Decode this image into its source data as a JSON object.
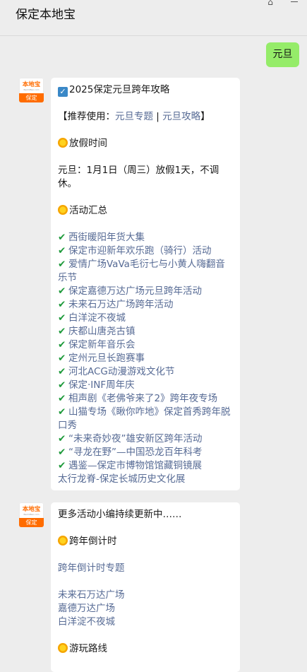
{
  "header": {
    "title": "保定本地宝",
    "pin_icon": "pin-icon",
    "minimize_icon": "minimize-icon"
  },
  "outgoing": {
    "text": "元旦"
  },
  "avatar": {
    "logo_text": "本地宝",
    "logo_sub": "BenDiBao.com",
    "city": "保定"
  },
  "message1": {
    "title": "2025保定元旦跨年攻略",
    "recommend_prefix": "【推荐使用：",
    "recommend_link1": "元旦专题",
    "recommend_sep": " | ",
    "recommend_link2": "元旦攻略",
    "recommend_suffix": "】",
    "holiday_heading": "放假时间",
    "holiday_text": "元旦：1月1日（周三）放假1天，不调休。",
    "events_heading": "活动汇总",
    "events": [
      "西街暖阳年货大集",
      "保定市迎新年欢乐跑（骑行）活动",
      "爱情广场VaVa毛衍七与小黄人嗨翻音乐节",
      "保定嘉德万达广场元旦跨年活动",
      "未来石万达广场跨年活动",
      "白洋淀不夜城",
      "庆都山唐尧古镇",
      "保定新年音乐会",
      "定州元旦长跑赛事",
      "河北ACG动漫游戏文化节",
      "保定·INF周年庆",
      "相声剧《老佛爷来了2》跨年夜专场",
      "山猫专场《瞅你咋地》保定首秀跨年脱口秀",
      "“未来奇妙夜”雄安新区跨年活动",
      "“寻龙在野”—中国恐龙百年科考",
      "遇鉴—保定市博物馆馆藏铜镜展"
    ],
    "events_last": "太行龙脊-保定长城历史文化展"
  },
  "message2": {
    "more_text": "更多活动小编持续更新中……",
    "countdown_heading": "跨年倒计时",
    "countdown_link": "跨年倒计时专题",
    "venues": [
      "未来石万达广场",
      "嘉德万达广场",
      "白洋淀不夜城"
    ],
    "route_heading": "游玩路线"
  }
}
